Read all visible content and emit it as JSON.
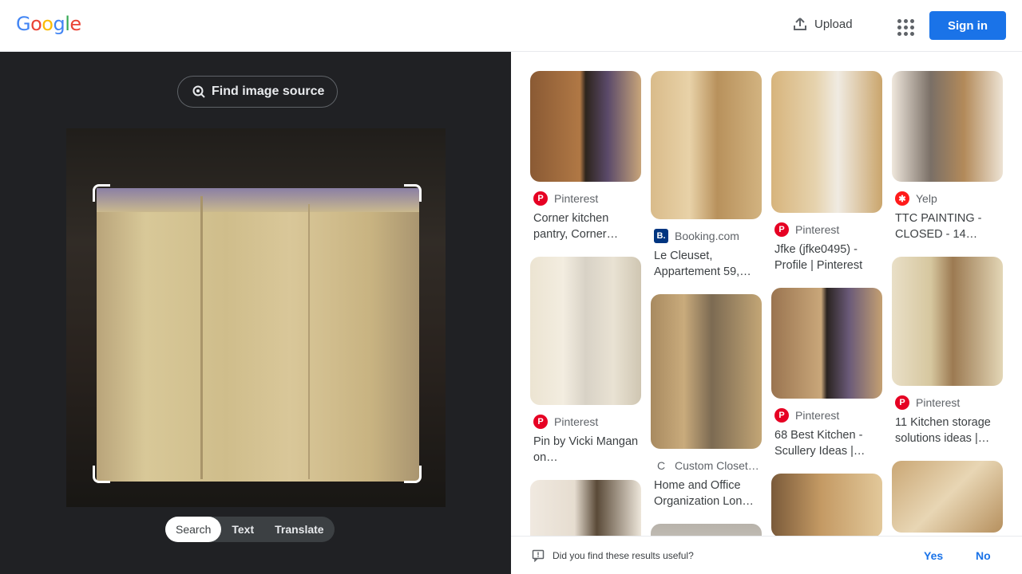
{
  "header": {
    "logo": [
      "G",
      "o",
      "o",
      "g",
      "l",
      "e"
    ],
    "logo_colors": [
      "#4285f4",
      "#ea4335",
      "#fbbc05",
      "#4285f4",
      "#34a853",
      "#ea4335"
    ],
    "upload_label": "Upload",
    "signin_label": "Sign in"
  },
  "left": {
    "find_source_label": "Find image source",
    "modes": [
      "Search",
      "Text",
      "Translate"
    ],
    "active_mode": "Search"
  },
  "results": [
    {
      "source": "Pinterest",
      "icon": "pinterest-icon",
      "title": "Corner kitchen pantry, Corner…"
    },
    {
      "source": "Pinterest",
      "icon": "pinterest-icon",
      "title": "Pin by Vicki Mangan on…"
    },
    {
      "source": "Booking.com",
      "icon": "booking-icon",
      "title": "Le Cleuset, Appartement 59,…"
    },
    {
      "source": "Custom Closet…",
      "icon": "custom-closet-icon",
      "title": "Home and Office Organization Lon…"
    },
    {
      "source": "Pinterest",
      "icon": "pinterest-icon",
      "title": "Jfke (jfke0495) - Profile | Pinterest"
    },
    {
      "source": "Pinterest",
      "icon": "pinterest-icon",
      "title": "68 Best Kitchen - Scullery Ideas |…"
    },
    {
      "source": "Yelp",
      "icon": "yelp-icon",
      "title": "TTC PAINTING - CLOSED - 14…"
    },
    {
      "source": "Pinterest",
      "icon": "pinterest-icon",
      "title": "11 Kitchen storage solutions ideas |…"
    }
  ],
  "feedback": {
    "question": "Did you find these results useful?",
    "yes": "Yes",
    "no": "No"
  },
  "colors": {
    "accent": "#1a73e8",
    "panel_dark": "#202124",
    "pinterest": "#e60023",
    "yelp": "#ff1a1a",
    "booking": "#003580"
  }
}
